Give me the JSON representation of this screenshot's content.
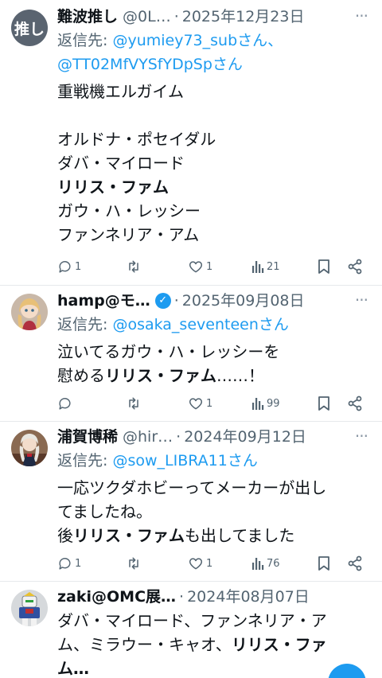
{
  "tweets": [
    {
      "avatar_text": "推し",
      "display_name": "難波推し",
      "handle": "@0L…",
      "separator": "·",
      "date": "2025年12月23日",
      "more": "···",
      "reply_prefix": "返信先: ",
      "reply_line1": "@yumiey73_subさん、",
      "reply_line2": "@TT02MfVYSfYDpSpさん",
      "lines": [
        "重戦機エルガイム",
        "",
        "オルドナ・ポセイダル",
        "ダバ・マイロード",
        "リリス・ファム",
        "ガウ・ハ・レッシー",
        "ファンネリア・アム"
      ],
      "replies": "1",
      "retweets": "",
      "likes": "1",
      "views": "21"
    },
    {
      "avatar_desc": "doll-avatar",
      "display_name": "hamp@モ…",
      "separator": "·",
      "date": "2025年09月08日",
      "more": "···",
      "reply_prefix": "返信先: ",
      "reply_line1": "@osaka_seventeenさん",
      "line1": "泣いてるガウ・ハ・レッシーを",
      "line2_a": "慰める",
      "line2_b": "リリス・ファム",
      "line2_c": "……！",
      "replies": "",
      "retweets": "",
      "likes": "1",
      "views": "99"
    },
    {
      "avatar_desc": "figure-avatar",
      "display_name": "浦賀博稀",
      "handle": "@hir…",
      "separator": "·",
      "date": "2024年09月12日",
      "more": "···",
      "reply_prefix": "返信先: ",
      "reply_line1": "@sow_LIBRA11さん",
      "line1": "一応ツクダホビーってメーカーが出し",
      "line2": "てましたね。",
      "line3_a": "後",
      "line3_b": "リリス・ファム",
      "line3_c": "も出してました",
      "replies": "1",
      "retweets": "",
      "likes": "1",
      "views": "76"
    },
    {
      "avatar_desc": "robot-avatar",
      "display_name": "zaki@OMC展…",
      "separator": "·",
      "date": "2024年08月07日",
      "line1": "ダバ・マイロード、ファンネリア・ア",
      "line2_a": "ム、ミラウー・キャオ、",
      "line2_b": "リリス・ファ",
      "line3": "ム…"
    }
  ],
  "colors": {
    "accent": "#1d9bf0",
    "secondary_text": "#536471",
    "primary_text": "#0f1419"
  }
}
